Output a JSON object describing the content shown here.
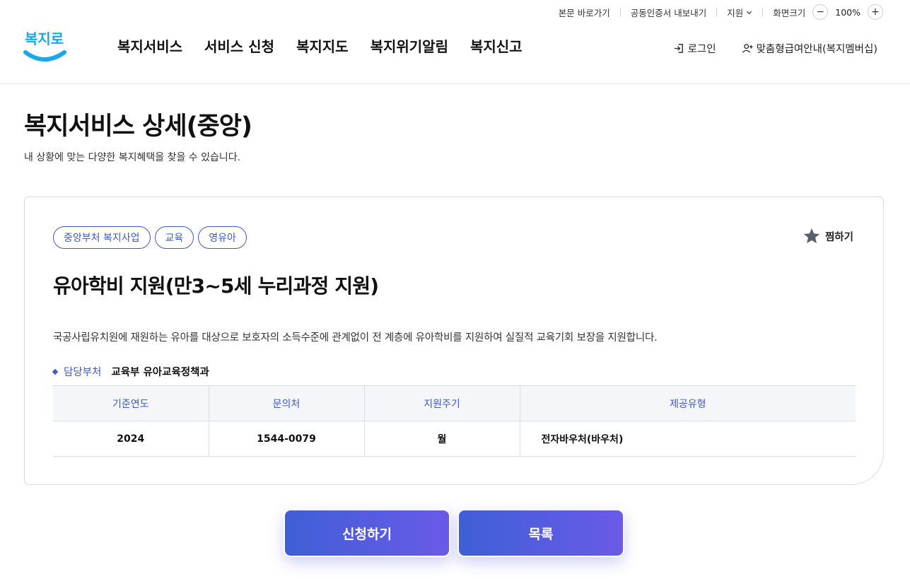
{
  "utility": {
    "skip_link": "본문 바로가기",
    "cert_export": "공동인증서 내보내기",
    "support": "지원",
    "screen_size": "화면크기",
    "zoom_minus": "−",
    "zoom_value": "100%",
    "zoom_plus": "+"
  },
  "header": {
    "logo_text": "복지로",
    "nav": [
      "복지서비스",
      "서비스 신청",
      "복지지도",
      "복지위기알림",
      "복지신고"
    ],
    "login": "로그인",
    "membership": "맞춤형급여안내(복지멤버십)"
  },
  "page": {
    "title": "복지서비스 상세(중앙)",
    "subtitle": "내 상황에 맞는 다양한 복지혜택을 찾을 수 있습니다."
  },
  "service": {
    "tags": [
      "중앙부처 복지사업",
      "교육",
      "영유아"
    ],
    "favorite": "찜하기",
    "title": "유아학비 지원(만3~5세 누리과정 지원)",
    "description": "국공사립유치원에 재원하는 유아를 대상으로 보호자의 소득수준에 관계없이 전 계층에 유아학비를 지원하여 실질적 교육기회 보장을 지원합니다.",
    "dept_label": "담당부처",
    "dept_value": "교육부 유아교육정책과",
    "table": {
      "headers": [
        "기준연도",
        "문의처",
        "지원주기",
        "제공유형"
      ],
      "row": [
        "2024",
        "1544-0079",
        "월",
        "전자바우처(바우처)"
      ]
    }
  },
  "buttons": {
    "apply": "신청하기",
    "list": "목록"
  },
  "colors": {
    "accent": "#3f58c7",
    "button_gradient_start": "#3f5fd6",
    "button_gradient_end": "#6a5ae8",
    "logo_blue": "#1aa7e8"
  }
}
